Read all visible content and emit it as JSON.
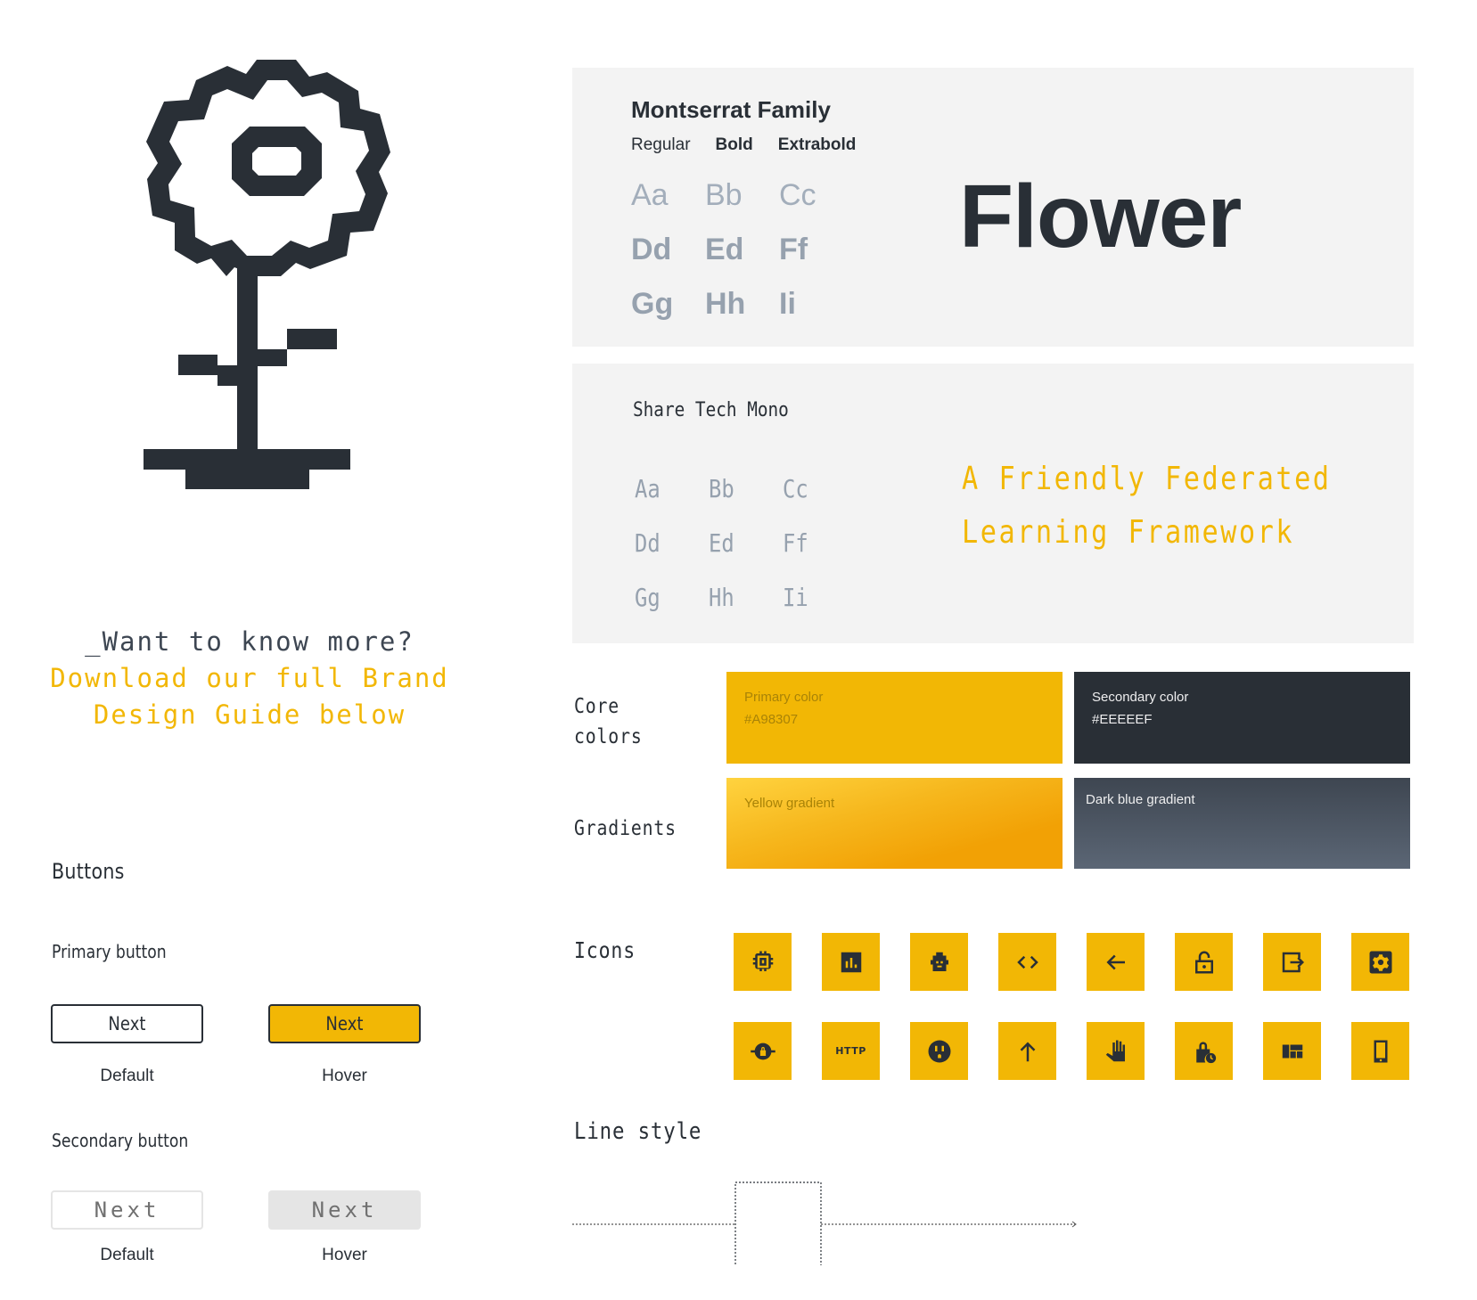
{
  "logo": {
    "name": "flower-logo",
    "color": "#292F36"
  },
  "cta": {
    "question": "_Want to know more?",
    "line1": "Download our full Brand",
    "line2": "Design Guide below"
  },
  "buttons": {
    "heading": "Buttons",
    "primary": {
      "label": "Primary button",
      "default": {
        "text": "Next",
        "state": "Default"
      },
      "hover": {
        "text": "Next",
        "state": "Hover"
      }
    },
    "secondary": {
      "label": "Secondary button",
      "default": {
        "text": "Next",
        "state": "Default"
      },
      "hover": {
        "text": "Next",
        "state": "Hover"
      }
    }
  },
  "typography": {
    "montserrat": {
      "title": "Montserrat Family",
      "weights": [
        "Regular",
        "Bold",
        "Extrabold"
      ],
      "glyphs": [
        [
          "Aa",
          "Bb",
          "Cc"
        ],
        [
          "Dd",
          "Ed",
          "Ff"
        ],
        [
          "Gg",
          "Hh",
          "Ii"
        ]
      ],
      "display_word": "Flower"
    },
    "share_tech_mono": {
      "title": "Share Tech Mono",
      "glyphs": [
        [
          "Aa",
          "Bb",
          "Cc"
        ],
        [
          "Dd",
          "Ed",
          "Ff"
        ],
        [
          "Gg",
          "Hh",
          "Ii"
        ]
      ],
      "tagline_line1": "A Friendly Federated",
      "tagline_line2": "Learning Framework"
    }
  },
  "colors": {
    "core_label_line1": "Core",
    "core_label_line2": "colors",
    "gradients_label": "Gradients",
    "primary": {
      "name": "Primary color",
      "hex": "#A98307",
      "fill": "#F2B705"
    },
    "secondary": {
      "name": "Secondary color",
      "hex": "#EEEEEF",
      "fill": "#292F36"
    },
    "yellow_gradient": {
      "name": "Yellow gradient"
    },
    "dark_blue_gradient": {
      "name": "Dark blue gradient"
    }
  },
  "icons": {
    "label": "Icons",
    "row1": [
      "chip-icon",
      "bar-chart-icon",
      "robot-icon",
      "code-icon",
      "arrow-left-icon",
      "lock-open-icon",
      "logout-icon",
      "settings-icon"
    ],
    "row2": [
      "vpn-lock-icon",
      "http-icon",
      "power-outlet-icon",
      "arrow-up-icon",
      "hand-icon",
      "lock-clock-icon",
      "dashboard-icon",
      "smartphone-icon"
    ],
    "http_text": "HTTP"
  },
  "line_style": {
    "label": "Line style"
  }
}
